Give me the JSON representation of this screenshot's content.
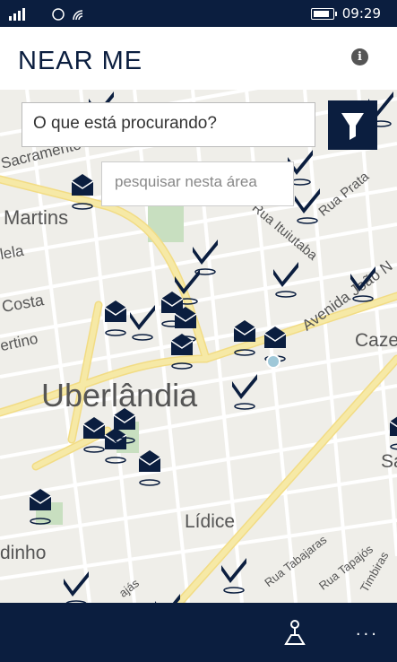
{
  "status_bar": {
    "time": "09:29"
  },
  "header": {
    "title": "NEAR ME",
    "info_icon": "info-icon"
  },
  "search": {
    "placeholder": "O que está procurando?"
  },
  "area_search": {
    "label": "pesquisar nesta área"
  },
  "map": {
    "labels": {
      "sacramento": "Sacramento",
      "martins": "Martins",
      "lela": "lela",
      "costa": "Costa",
      "ertino": "ertino",
      "uberlandia": "Uberlândia",
      "lidice": "Lídice",
      "dinho": "dinho",
      "rua_prata": "Rua Prata",
      "rua_ituiutaba": "Rua Ituiutaba",
      "avenida": "Avenida João N",
      "caze": "Caze",
      "sa": "Sa",
      "rua_tabajaras": "Rua Tabajaras",
      "rua_tapajos": "Rua Tapajós",
      "timbiras": "Timbiras",
      "ajas": "ajás"
    }
  },
  "app_bar": {
    "directions_icon": "directions-icon",
    "more_label": "..."
  },
  "colors": {
    "navy": "#0b1e3f",
    "road": "#f6e9a6",
    "map_bg": "#efeee9"
  }
}
